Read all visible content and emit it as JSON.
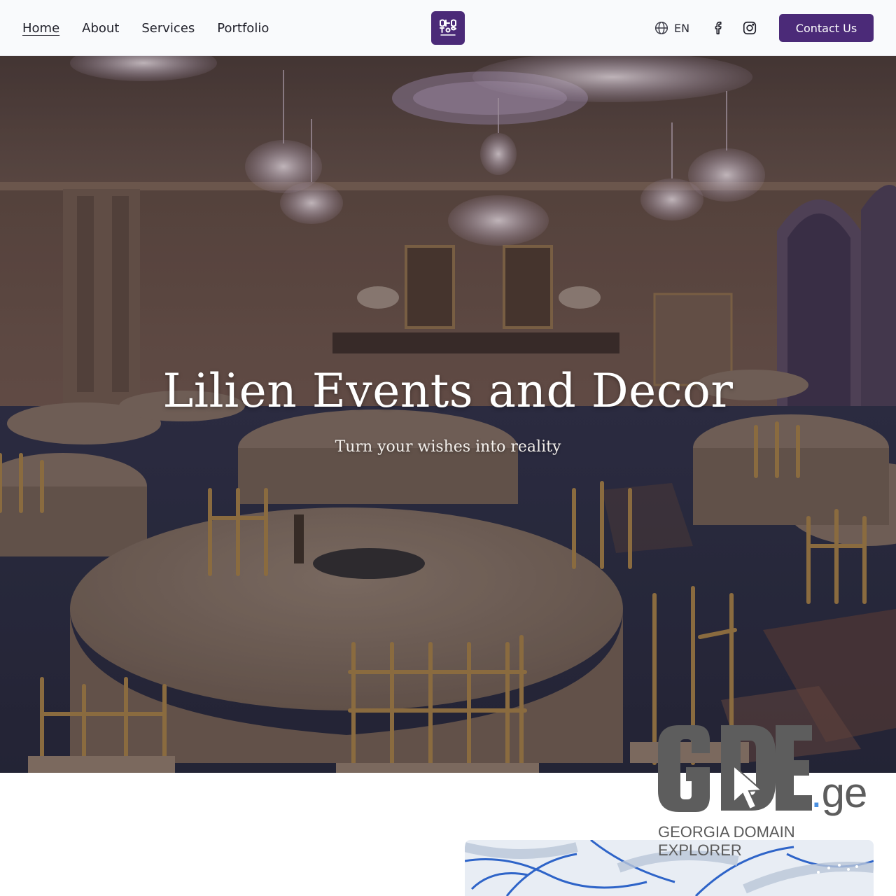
{
  "nav": {
    "links": [
      {
        "label": "Home",
        "active": true
      },
      {
        "label": "About"
      },
      {
        "label": "Services"
      },
      {
        "label": "Portfolio"
      }
    ],
    "logo_icon": "lilien-monogram-logo",
    "language": {
      "label": "EN",
      "icon": "globe-icon"
    },
    "social": [
      {
        "network": "facebook",
        "icon": "facebook-icon"
      },
      {
        "network": "instagram",
        "icon": "instagram-icon"
      }
    ],
    "cta_label": "Contact Us"
  },
  "hero": {
    "title": "Lilien Events and Decor",
    "subtitle": "Turn your wishes into reality",
    "background": "ballroom-photo"
  },
  "watermark": {
    "brand": "GDE",
    "domain": ".ge",
    "caption": "GEORGIA DOMAIN EXPLORER"
  },
  "colors": {
    "brand_purple": "#4b2a78",
    "nav_bg": "#f9fafc",
    "watermark_gray": "#5d5d5d",
    "watermark_dot_blue": "#4a8fe0"
  }
}
